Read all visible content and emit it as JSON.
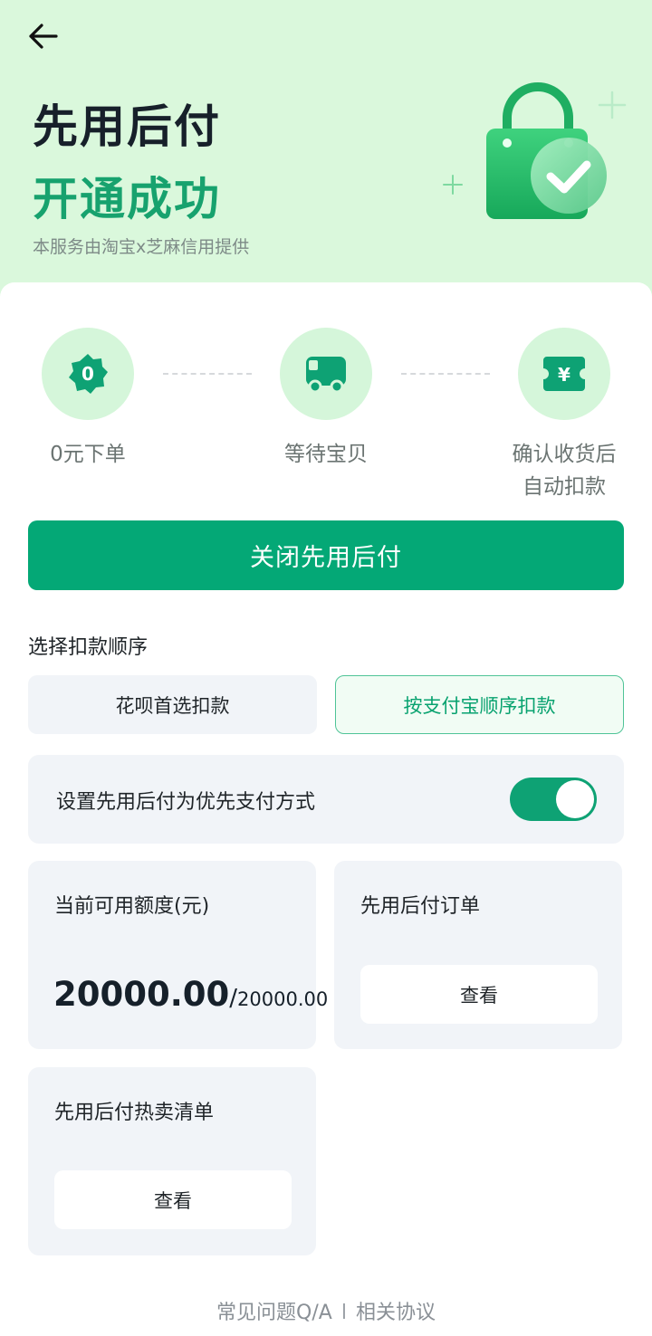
{
  "header": {
    "title_line1": "先用后付",
    "title_line2": "开通成功",
    "provider_text": "本服务由淘宝x芝麻信用提供"
  },
  "steps": [
    {
      "label": "0元下单",
      "icon": "zero-badge-icon",
      "badge_text": "0"
    },
    {
      "label": "等待宝贝",
      "icon": "truck-icon"
    },
    {
      "label_line1": "确认收货后",
      "label_line2": "自动扣款",
      "icon": "yuan-ticket-icon",
      "badge_text": "¥"
    }
  ],
  "main_button": {
    "label": "关闭先用后付"
  },
  "deduction": {
    "section_label": "选择扣款顺序",
    "options": [
      {
        "label": "花呗首选扣款",
        "selected": false
      },
      {
        "label": "按支付宝顺序扣款",
        "selected": true
      }
    ]
  },
  "priority_setting": {
    "label": "设置先用后付为优先支付方式",
    "enabled": true
  },
  "quota": {
    "title": "当前可用额度(元)",
    "available": "20000.00",
    "separator": "/",
    "total": "20000.00"
  },
  "orders": {
    "title": "先用后付订单",
    "button_label": "查看"
  },
  "hot_list": {
    "title": "先用后付热卖清单",
    "button_label": "查看"
  },
  "footer": {
    "faq_link": "常见问题Q/A",
    "divider": "l",
    "agreement_link": "相关协议"
  },
  "colors": {
    "brand_green": "#04a876",
    "title_green": "#17a26e",
    "header_bg": "#daf8dc",
    "panel_bg": "#f1f4f8"
  }
}
